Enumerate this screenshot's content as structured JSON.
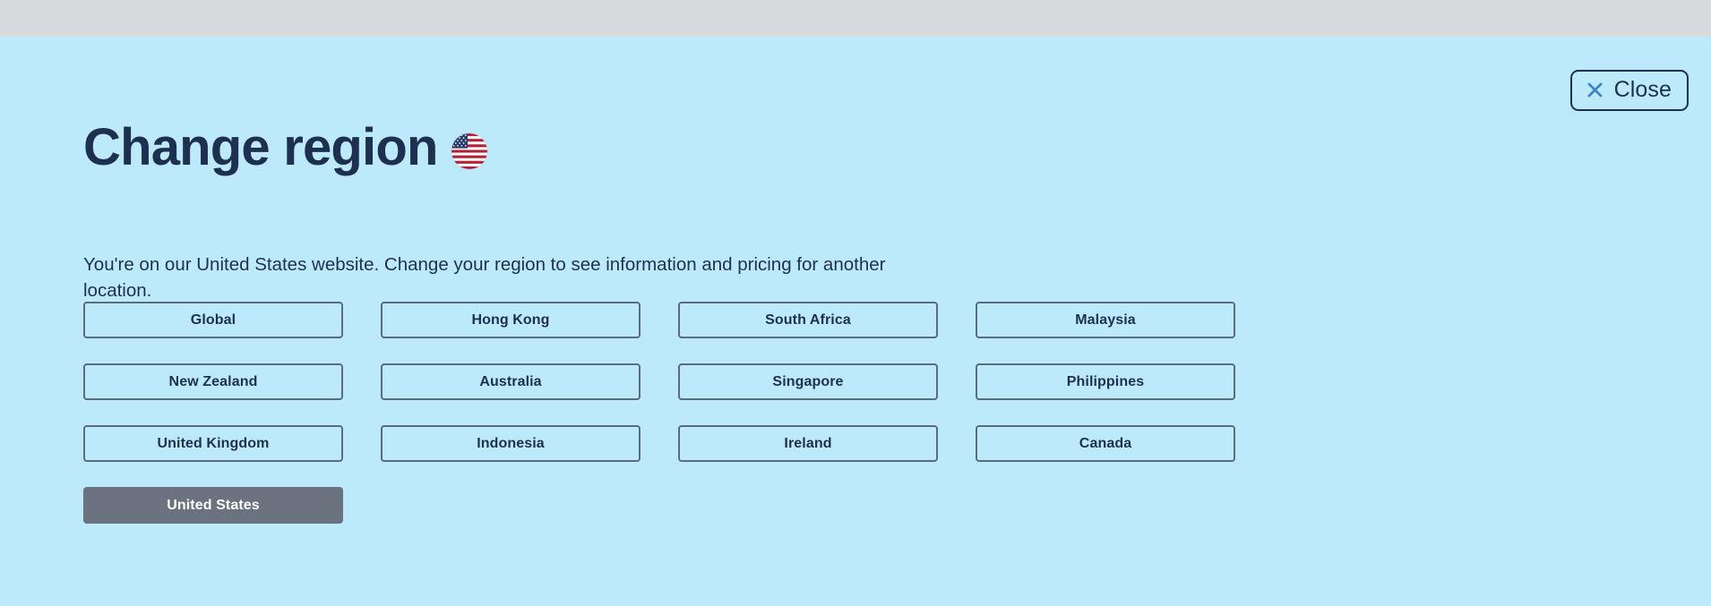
{
  "colors": {
    "top_strip": "#d8dadd",
    "panel_background": "#bdeafb",
    "text_navy": "#1e3050",
    "button_border": "#5a6b7d",
    "active_button_background": "#6b7280",
    "close_icon_blue": "#3f84c6"
  },
  "close": {
    "label": "Close",
    "icon": "close-x-icon"
  },
  "header": {
    "title": "Change region",
    "flag_icon": "united-states-flag-icon"
  },
  "description": "You're on our United States website. Change your region to see information and pricing for another location.",
  "regions": [
    {
      "label": "Global",
      "active": false
    },
    {
      "label": "Hong Kong",
      "active": false
    },
    {
      "label": "South Africa",
      "active": false
    },
    {
      "label": "Malaysia",
      "active": false
    },
    {
      "label": "New Zealand",
      "active": false
    },
    {
      "label": "Australia",
      "active": false
    },
    {
      "label": "Singapore",
      "active": false
    },
    {
      "label": "Philippines",
      "active": false
    },
    {
      "label": "United Kingdom",
      "active": false
    },
    {
      "label": "Indonesia",
      "active": false
    },
    {
      "label": "Ireland",
      "active": false
    },
    {
      "label": "Canada",
      "active": false
    }
  ],
  "current_region": {
    "label": "United States",
    "active": true
  }
}
